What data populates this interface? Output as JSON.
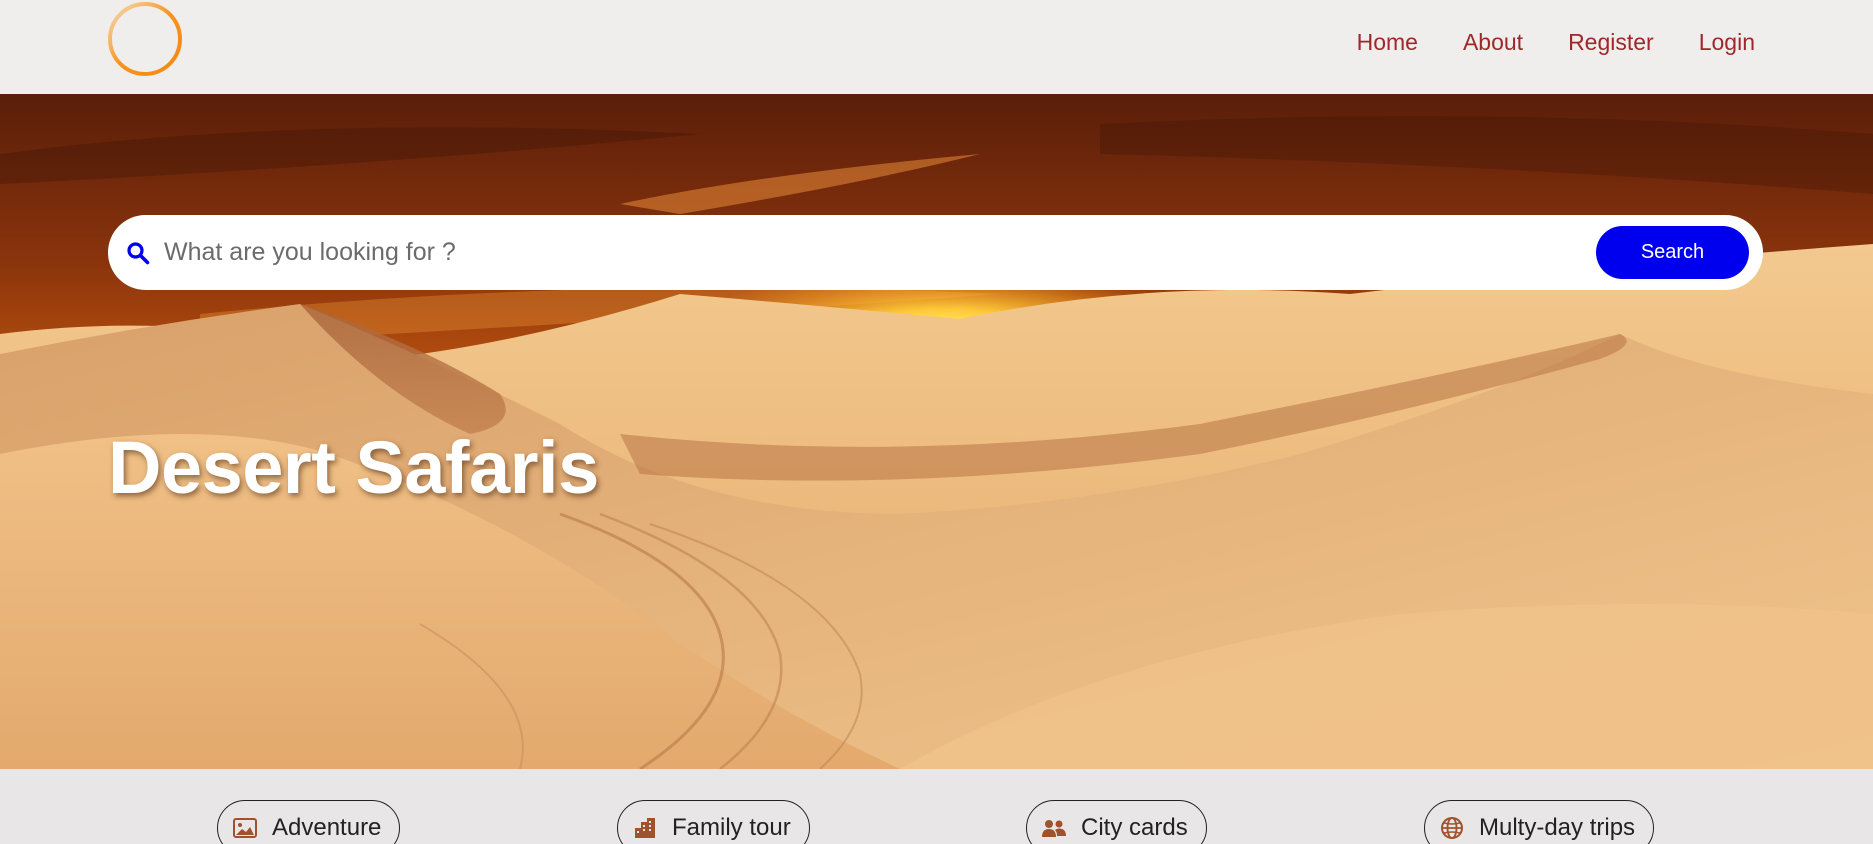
{
  "header": {
    "logo_name": "orange-ring-logo",
    "nav": [
      {
        "label": "Home"
      },
      {
        "label": "About"
      },
      {
        "label": "Register"
      },
      {
        "label": "Login"
      }
    ],
    "nav_color": "#a0282a"
  },
  "hero": {
    "title": "Desert Safaris",
    "search": {
      "placeholder": "What are you looking for ?",
      "value": "",
      "button_label": "Search",
      "button_color": "#0000ee",
      "icon": "search-icon"
    }
  },
  "categories": [
    {
      "label": "Adventure",
      "icon": "image-icon"
    },
    {
      "label": "Family tour",
      "icon": "building-icon"
    },
    {
      "label": "City cards",
      "icon": "users-icon"
    },
    {
      "label": "Multy-day trips",
      "icon": "globe-icon"
    }
  ],
  "colors": {
    "accent_brown": "#a0522d",
    "logo_orange": "#f7931e"
  }
}
